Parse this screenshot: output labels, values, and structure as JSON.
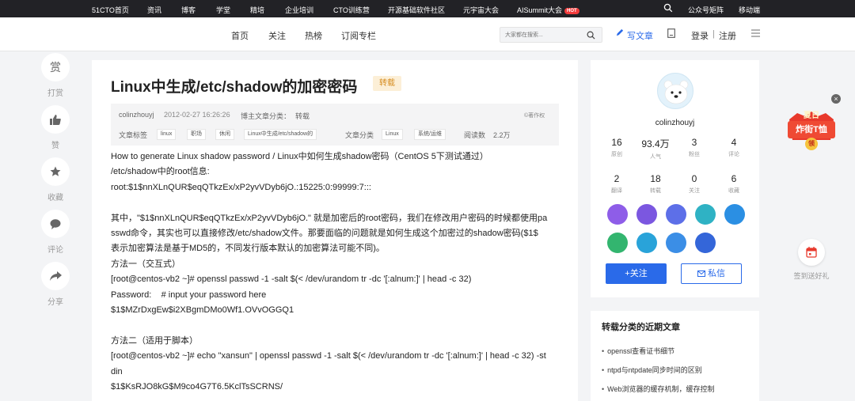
{
  "topbar": {
    "items": [
      "51CTO首页",
      "资讯",
      "博客",
      "学堂",
      "精培",
      "企业培训",
      "CTO训练营",
      "开源基础软件社区",
      "元宇宙大会",
      "AISummit大会"
    ],
    "hot_badge": "HOT",
    "right_items": [
      "公众号矩阵",
      "移动端"
    ]
  },
  "nav": {
    "items": [
      "首页",
      "关注",
      "热榜",
      "订阅专栏"
    ],
    "search_placeholder": "大家都在搜索...",
    "write": "写文章",
    "login": "登录",
    "sep": "|",
    "register": "注册"
  },
  "left_float": [
    {
      "icon_text": "赏",
      "label": "打赏"
    },
    {
      "icon_text": "",
      "label": "赞"
    },
    {
      "icon_text": "",
      "label": "收藏"
    },
    {
      "icon_text": "",
      "label": "评论"
    },
    {
      "icon_text": "",
      "label": "分享"
    }
  ],
  "article": {
    "title": "Linux中生成/etc/shadow的加密密码",
    "badge": "转载",
    "author": "colinzhouyj",
    "date": "2012-02-27 16:26:26",
    "blog_category_label": "博主文章分类：",
    "blog_category": "转载",
    "copyright": "©著作权",
    "tags_label": "文章标签",
    "tags": [
      "linux",
      "职场",
      "休闲",
      "Linux中生成/etc/shadow的"
    ],
    "category_label": "文章分类",
    "categories": [
      "Linux",
      "系统/运维"
    ],
    "reads_label": "阅读数",
    "reads": "2.2万",
    "body": [
      "How to generate Linux shadow password / Linux中如何生成shadow密码（CentOS 5下测试通过）",
      "/etc/shadow中的root信息:",
      "root:$1$nnXLnQUR$eqQTkzEx/xP2yvVDyb6jO.:15225:0:99999:7:::",
      "",
      "其中，\"$1$nnXLnQUR$eqQTkzEx/xP2yvVDyb6jO.\" 就是加密后的root密码，我们在修改用户密码的时候都使用pa",
      "sswd命令，其实也可以直接修改/etc/shadow文件。那要面临的问题就是如何生成这个加密过的shadow密码($1$",
      "表示加密算法是基于MD5的，不同发行版本默认的加密算法可能不同)。",
      "方法一（交互式）",
      "[root@centos-vb2 ~]# openssl passwd -1 -salt $(< /dev/urandom tr -dc '[:alnum:]' | head -c 32)",
      "Password:    # input your password here",
      "$1$MZrDxgEw$i2XBgmDMo0Wf1.OVvOGGQ1",
      "",
      "方法二（适用于脚本）",
      "[root@centos-vb2 ~]# echo \"xansun\" | openssl passwd -1 -salt $(< /dev/urandom tr -dc '[:alnum:]' | head -c 32) -st",
      "din",
      "$1$KsRJO8kG$M9co4G7T6.5KclTsSCRNS/"
    ]
  },
  "author_card": {
    "name": "colinzhouyj",
    "stats_row1": [
      {
        "n": "16",
        "l": "原创"
      },
      {
        "n": "93.4万",
        "l": "人气"
      },
      {
        "n": "3",
        "l": "粉丝"
      },
      {
        "n": "4",
        "l": "评论"
      }
    ],
    "stats_row2": [
      {
        "n": "2",
        "l": "翻译"
      },
      {
        "n": "18",
        "l": "转载"
      },
      {
        "n": "0",
        "l": "关注"
      },
      {
        "n": "6",
        "l": "收藏"
      }
    ],
    "follow": "+关注",
    "message": "私信"
  },
  "recent": {
    "heading": "转载分类的近期文章",
    "items": [
      "openssl查看证书细节",
      "ntpd与ntpdate同步时间的区别",
      "Web浏览器的缓存机制，缓存控制"
    ]
  },
  "promo": {
    "line1": "夏日",
    "line2": "炸街T恤",
    "line3": "领"
  },
  "gift": {
    "label": "签到送好礼"
  },
  "colors": {
    "accent": "#2a6ae9",
    "topbar": "#222226",
    "badge_bg": "#fcefd7",
    "badge_text": "#d58b1e",
    "promo": "#e8392c"
  }
}
